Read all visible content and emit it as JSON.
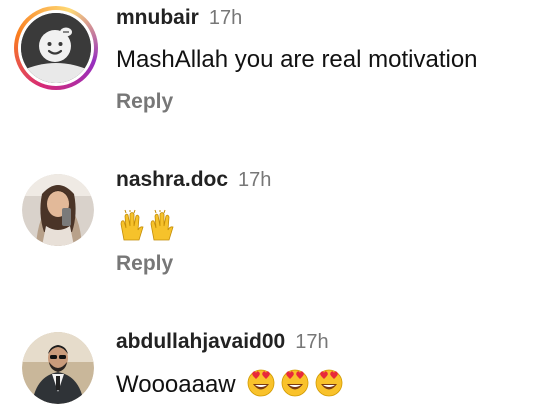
{
  "comments": [
    {
      "username": "mnubair",
      "time": "17h",
      "text": "MashAllah you are real motivation",
      "reply_label": "Reply",
      "avatar_icon": "default-avatar-icon",
      "has_story_ring": true
    },
    {
      "username": "nashra.doc",
      "time": "17h",
      "emoji": "raising-hands x2",
      "reply_label": "Reply",
      "avatar_icon": "profile-photo"
    },
    {
      "username": "abdullahjavaid00",
      "time": "17h",
      "text": "Woooaaaw",
      "emoji": "smiling-face-with-heart-eyes x3",
      "avatar_icon": "profile-photo"
    }
  ],
  "colors": {
    "username": "#222222",
    "time": "#777777",
    "reply": "#777777",
    "story_ring": [
      "#d62976",
      "#fa7e1e",
      "#feda75",
      "#962fbf"
    ]
  }
}
